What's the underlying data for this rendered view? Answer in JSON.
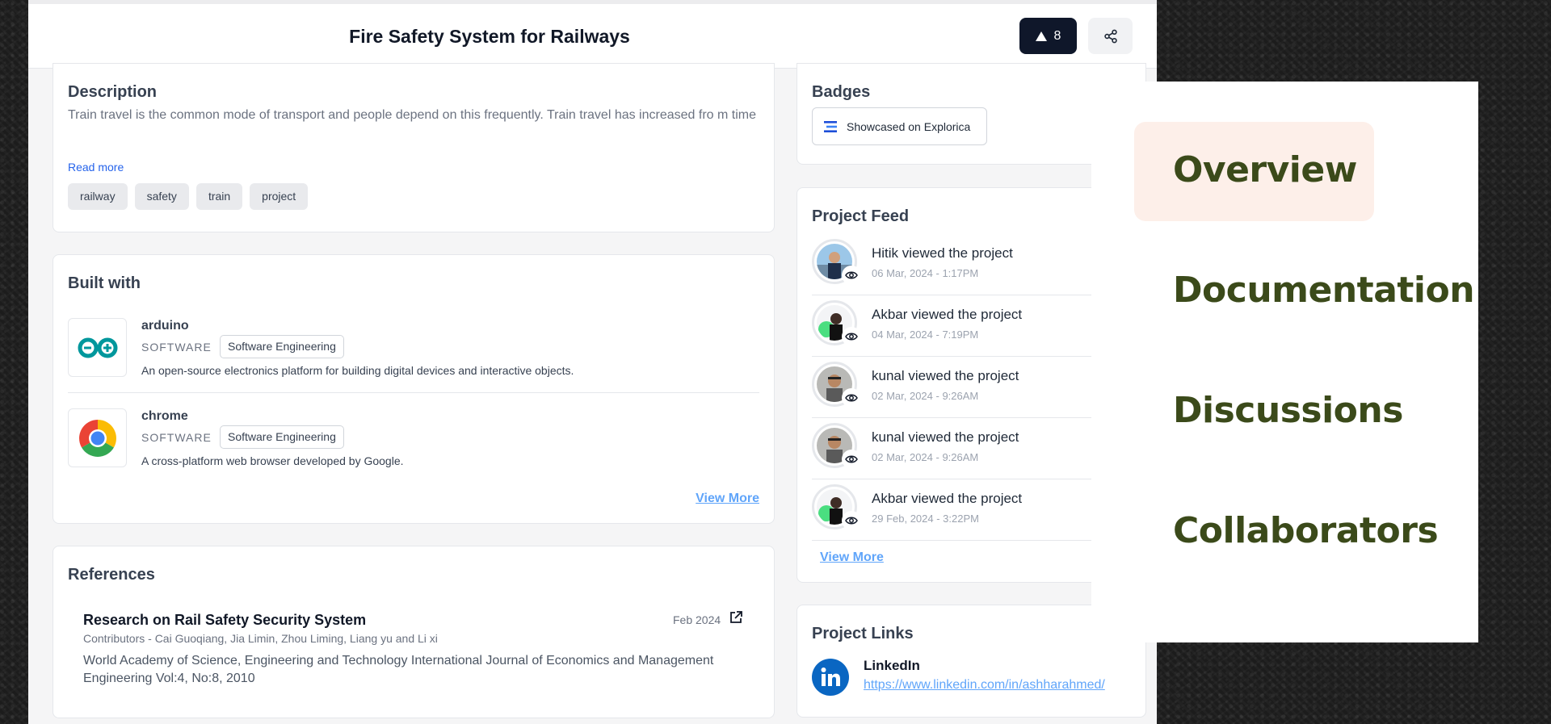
{
  "header": {
    "title": "Fire Safety System for Railways",
    "upvotes": "8",
    "share_icon": "share-icon"
  },
  "description": {
    "heading": "Description",
    "text": "Train travel is the common mode of transport and people depend on this frequently. Train travel has increased fro m time",
    "read_more": "Read more",
    "tags": [
      "railway",
      "safety",
      "train",
      "project"
    ]
  },
  "built_with": {
    "heading": "Built with",
    "tools": [
      {
        "name": "arduino",
        "type": "SOFTWARE",
        "category": "Software Engineering",
        "desc": "An open-source electronics platform for building digital devices and interactive objects.",
        "icon": "arduino-logo-icon"
      },
      {
        "name": "chrome",
        "type": "SOFTWARE",
        "category": "Software Engineering",
        "desc": "A cross-platform web browser developed by Google.",
        "icon": "chrome-logo-icon"
      }
    ],
    "view_more": "View More"
  },
  "references": {
    "heading": "References",
    "items": [
      {
        "title": "Research on Rail Safety Security System",
        "date": "Feb 2024",
        "contributors": "Contributors - Cai Guoqiang, Jia Limin, Zhou Liming, Liang yu and Li xi",
        "desc": "World Academy of Science, Engineering and Technology International Journal of Economics and Management Engineering Vol:4, No:8, 2010"
      }
    ]
  },
  "badges": {
    "heading": "Badges",
    "items": [
      {
        "label": "Showcased on Explorica",
        "icon": "explorica-logo-icon"
      }
    ]
  },
  "feed": {
    "heading": "Project Feed",
    "items": [
      {
        "text": "Hitik viewed the project",
        "time": "06 Mar, 2024 - 1:17PM"
      },
      {
        "text": "Akbar viewed the project",
        "time": "04 Mar, 2024 - 7:19PM"
      },
      {
        "text": "kunal viewed the project",
        "time": "02 Mar, 2024 - 9:26AM"
      },
      {
        "text": "kunal viewed the project",
        "time": "02 Mar, 2024 - 9:26AM"
      },
      {
        "text": "Akbar viewed the project",
        "time": "29 Feb, 2024 - 3:22PM"
      }
    ],
    "view_more": "View More"
  },
  "project_links": {
    "heading": "Project Links",
    "items": [
      {
        "title": "LinkedIn",
        "url": "https://www.linkedin.com/in/ashharahmed/"
      }
    ]
  },
  "zoom_nav": {
    "items": [
      "Overview",
      "Documentation",
      "Discussions",
      "Collaborators"
    ],
    "active": "Overview",
    "colors": {
      "text": "#3b4a1a",
      "active_bg": "#fdefe9"
    }
  },
  "colors": {
    "primary_dark": "#0f172a",
    "link": "#60a5fa",
    "read_more": "#2563eb"
  }
}
